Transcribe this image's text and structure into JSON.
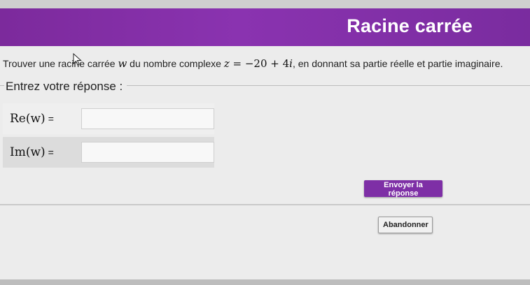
{
  "banner": {
    "title": "Racine carrée"
  },
  "question": {
    "prefix": "Trouver une racine carrée ",
    "var_w": "w",
    "middle": " du nombre complexe ",
    "var_z": "z",
    "equation": " = −20 + 4",
    "var_i": "i",
    "suffix": ", en donnant sa partie réelle et partie imaginaire."
  },
  "answer_section": {
    "legend": "Entrez votre réponse :",
    "fields": [
      {
        "label": "Re(w)",
        "eq": "=",
        "value": ""
      },
      {
        "label": "Im(w)",
        "eq": "=",
        "value": ""
      }
    ]
  },
  "buttons": {
    "submit_label": "Envoyer la réponse",
    "abort_label": "Abandonner"
  },
  "colors": {
    "accent": "#7e2fa6",
    "banner": "#8a33b0"
  }
}
